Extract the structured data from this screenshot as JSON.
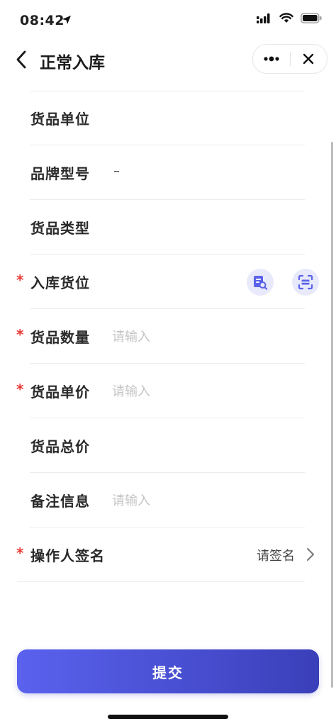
{
  "status_bar": {
    "time": "08:42",
    "icons": [
      "location-arrow-icon",
      "cellular-signal-icon",
      "wifi-icon",
      "battery-icon"
    ]
  },
  "nav": {
    "title": "正常入库",
    "back_icon": "back-chevron-icon",
    "more_icon": "more-dots-icon",
    "close_icon": "close-icon"
  },
  "form": {
    "rows": [
      {
        "label": "货品单位",
        "required": false,
        "value": ""
      },
      {
        "label": "品牌型号",
        "required": false,
        "value": "–"
      },
      {
        "label": "货品类型",
        "required": false,
        "value": ""
      },
      {
        "label": "入库货位",
        "required": true,
        "actions": [
          "document-search-icon",
          "scan-icon"
        ]
      },
      {
        "label": "货品数量",
        "required": true,
        "value": "",
        "placeholder": "请输入"
      },
      {
        "label": "货品单价",
        "required": true,
        "value": "",
        "placeholder": "请输入"
      },
      {
        "label": "货品总价",
        "required": false,
        "value": ""
      },
      {
        "label": "备注信息",
        "required": false,
        "value": "",
        "placeholder": "请输入"
      },
      {
        "label": "操作人签名",
        "required": true,
        "action_text": "请签名",
        "action_icon": "chevron-right-icon"
      }
    ],
    "required_mark": "*"
  },
  "submit": {
    "label": "提交"
  },
  "colors": {
    "accent_start": "#5a62ee",
    "accent_end": "#3a3fb9",
    "required": "#e53935",
    "placeholder": "#c4c4c4",
    "icon_bg": "#e8eafb"
  }
}
